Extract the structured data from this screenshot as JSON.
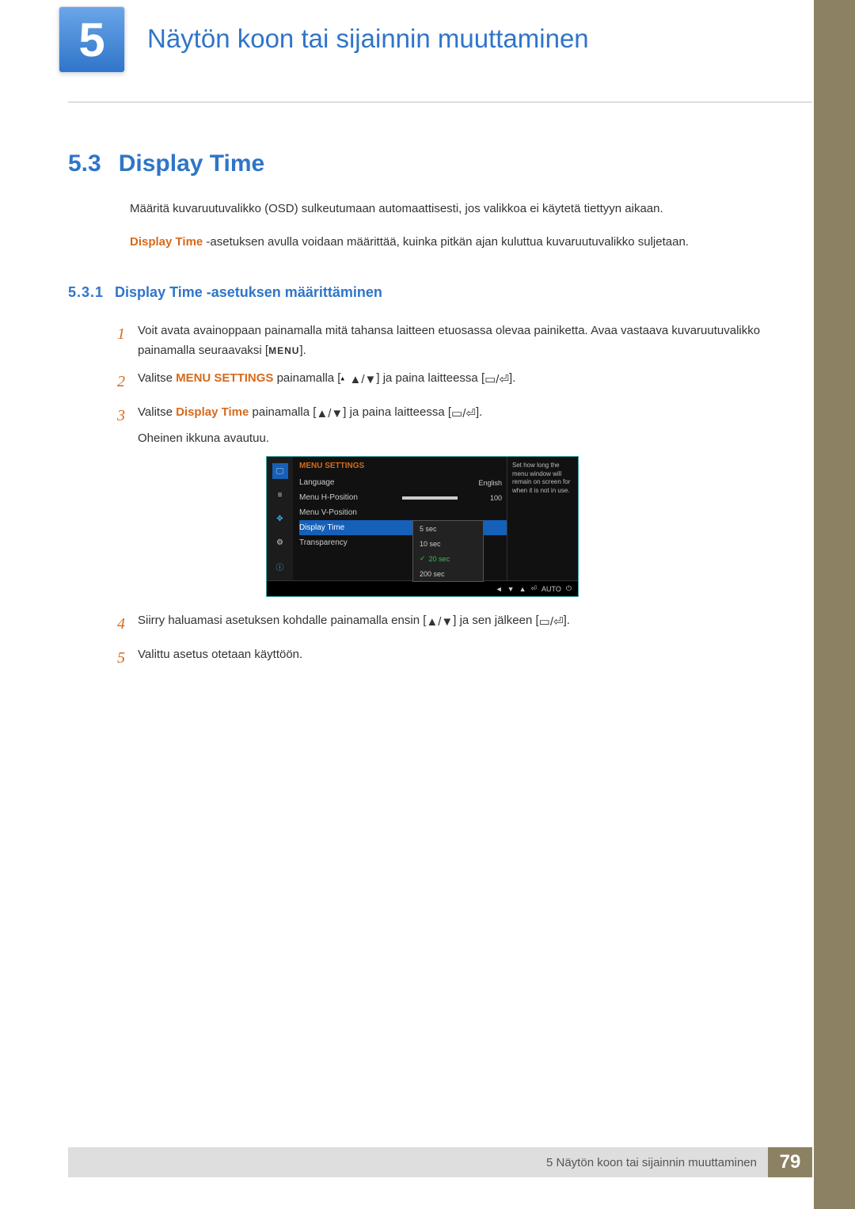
{
  "chapter": {
    "number": "5",
    "title": "Näytön koon tai sijainnin muuttaminen"
  },
  "section": {
    "number": "5.3",
    "title": "Display Time"
  },
  "paragraphs": {
    "p1": "Määritä kuvaruutuvalikko (OSD) sulkeutumaan automaattisesti, jos valikkoa ei käytetä tiettyyn aikaan.",
    "p2_lead": "Display Time",
    "p2_rest": " -asetuksen avulla voidaan määrittää, kuinka pitkän ajan kuluttua kuvaruutuvalikko suljetaan."
  },
  "subsection": {
    "number": "5.3.1",
    "title": "Display Time -asetuksen määrittäminen"
  },
  "steps": {
    "s1": "Voit avata avainoppaan painamalla mitä tahansa laitteen etuosassa olevaa painiketta. Avaa vastaava kuvaruutuvalikko painamalla seuraavaksi [",
    "s1_menu": "MENU",
    "s1_end": "].",
    "s2_a": "Valitse ",
    "s2_b": "MENU SETTINGS",
    "s2_c": " painamalla [",
    "s2_d": "] ja paina laitteessa [",
    "s2_e": "].",
    "s3_a": "Valitse ",
    "s3_b": "Display Time",
    "s3_c": " painamalla [",
    "s3_d": "] ja paina laitteessa [",
    "s3_e": "].",
    "s3_f": "Oheinen ikkuna avautuu.",
    "s4_a": "Siirry haluamasi asetuksen kohdalle painamalla ensin [",
    "s4_b": "] ja sen jälkeen [",
    "s4_c": "].",
    "s5": "Valittu asetus otetaan käyttöön."
  },
  "osd": {
    "title": "MENU SETTINGS",
    "rows": {
      "language": "Language",
      "language_val": "English",
      "hpos": "Menu H-Position",
      "hpos_val": "100",
      "vpos": "Menu V-Position",
      "display_time": "Display Time",
      "transparency": "Transparency"
    },
    "dropdown": {
      "o1": "5 sec",
      "o2": "10 sec",
      "o3": "20 sec",
      "o4": "200 sec"
    },
    "help": "Set how long the menu window will remain on screen for when it is not in use.",
    "auto": "AUTO"
  },
  "footer": {
    "text": "5 Näytön koon tai sijainnin muuttaminen",
    "page": "79"
  }
}
